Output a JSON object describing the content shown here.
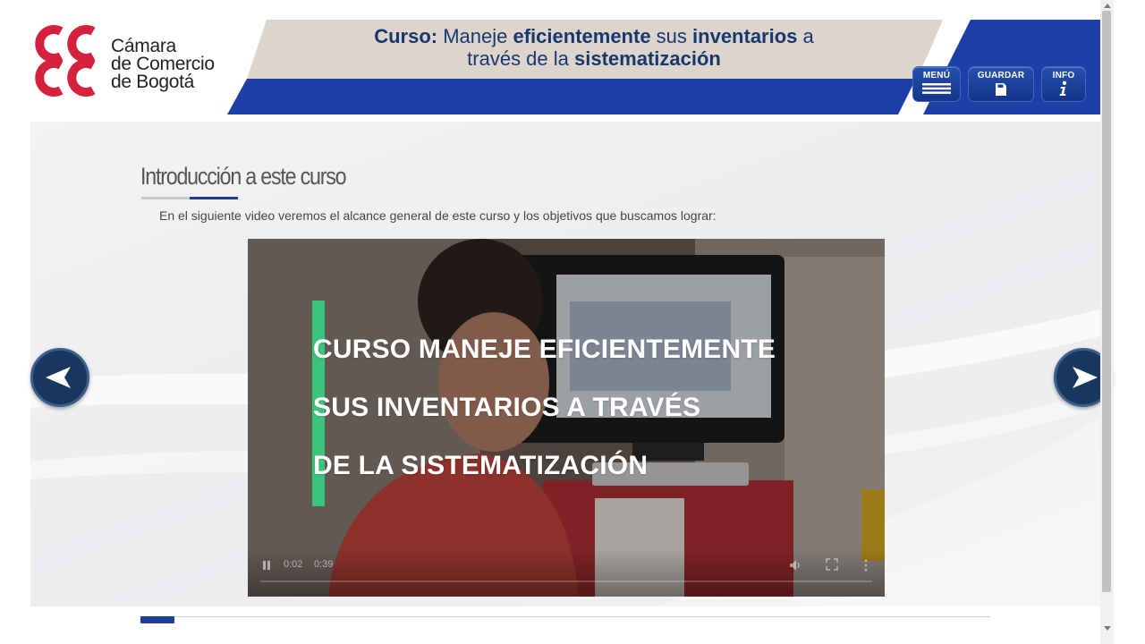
{
  "header": {
    "logo": {
      "line1": "Cámara",
      "line2": "de Comercio",
      "line3": "de Bogotá",
      "color": "#d4213d"
    },
    "course_title": {
      "part1": "Curso:",
      "part2": " Maneje ",
      "part3": "eficientemente",
      "part4": " sus ",
      "part5": "inventarios",
      "part6": " a",
      "part7": "través de la ",
      "part8": "sistematización"
    },
    "buttons": {
      "menu": "MENÚ",
      "save": "GUARDAR",
      "info": "INFO"
    },
    "colors": {
      "banner_blue": "#1e3fa8",
      "banner_beige": "#ddd5cc",
      "title_navy": "#17386e"
    }
  },
  "content": {
    "section_title": "Introducción a este curso",
    "intro_text": "En el siguiente video veremos el alcance general de este curso y los objetivos que buscamos lograr:",
    "video": {
      "caption_line1": "CURSO MANEJE EFICIENTEMENTE",
      "caption_line2": "SUS INVENTARIOS A TRAVÉS",
      "caption_line3": "DE LA SISTEMATIZACIÓN",
      "time_current": "0:02",
      "time_total": "0:39",
      "accent_color": "#3ac47d"
    }
  },
  "navigation": {
    "prev_icon": "arrow-left-icon",
    "next_icon": "arrow-right-icon"
  },
  "progress": {
    "fraction": 0.04
  }
}
